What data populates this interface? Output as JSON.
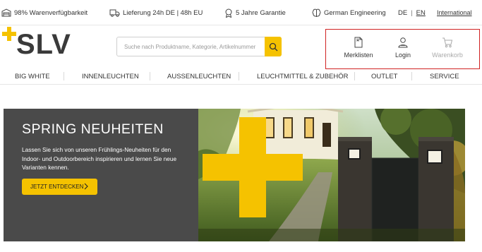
{
  "topbar": {
    "availability": "98% Warenverfügbarkeit",
    "delivery": "Lieferung 24h DE | 48h EU",
    "guarantee": "5 Jahre Garantie",
    "engineering": "German Engineering",
    "lang_de": "DE",
    "lang_sep": "|",
    "lang_en": "EN",
    "international": "International"
  },
  "header": {
    "logo_text": "SLV",
    "search_placeholder": "Suche nach Produktname, Kategorie, Artikelnummer",
    "merklisten": "Merklisten",
    "login": "Login",
    "warenkorb": "Warenkorb"
  },
  "nav": {
    "items": [
      "BIG WHITE",
      "INNENLEUCHTEN",
      "AUSSENLEUCHTEN",
      "LEUCHTMITTEL & ZUBEHÖR",
      "OUTLET",
      "SERVICE"
    ]
  },
  "hero": {
    "title": "SPRING NEUHEITEN",
    "text": "Lassen Sie sich von unseren Frühlings-Neuheiten für den Indoor- und Outdoorbereich inspirieren und lernen Sie neue Varianten kennen.",
    "cta": "JETZT ENTDECKEN"
  },
  "colors": {
    "accent": "#f5c200",
    "hero_panel": "#4a4a4a",
    "highlight_border": "#d02222"
  }
}
